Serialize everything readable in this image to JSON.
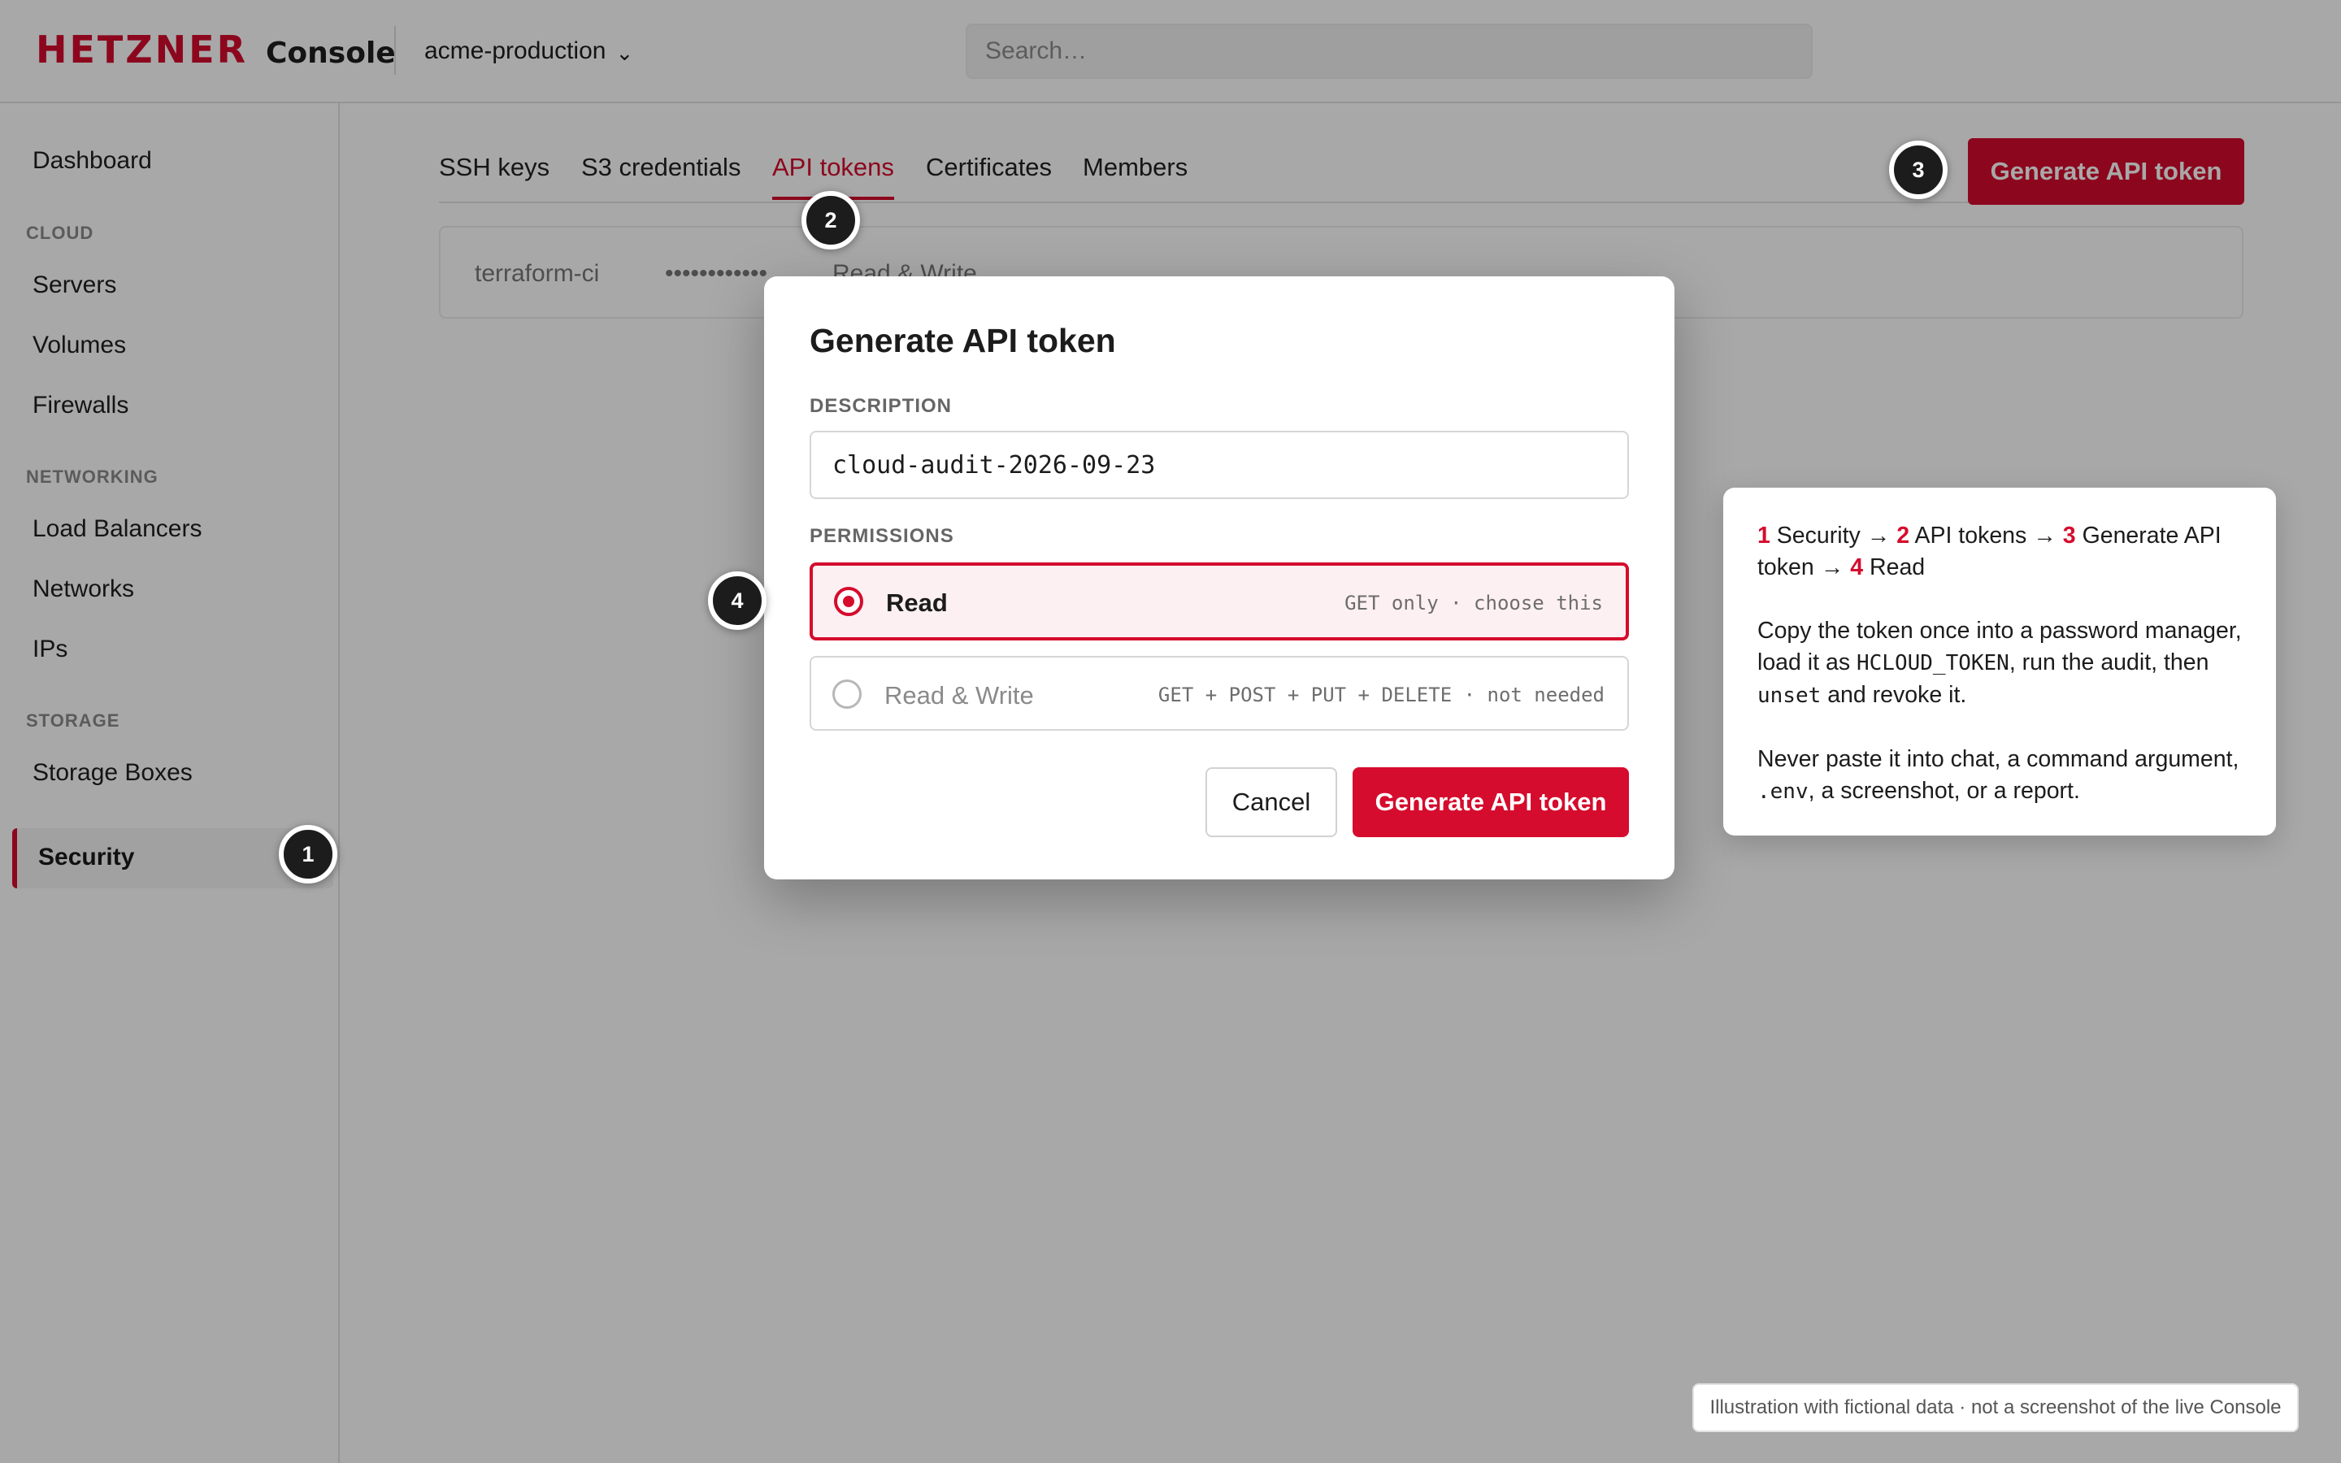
{
  "header": {
    "brand": "HETZNER",
    "product": "Console",
    "project": "acme-production",
    "project_chevron": "⌄",
    "search_placeholder": "Search…"
  },
  "sidebar": {
    "dashboard": "Dashboard",
    "sections": [
      {
        "title": "CLOUD",
        "items": [
          "Servers",
          "Volumes",
          "Firewalls"
        ]
      },
      {
        "title": "NETWORKING",
        "items": [
          "Load Balancers",
          "Networks",
          "IPs"
        ]
      },
      {
        "title": "STORAGE",
        "items": [
          "Storage Boxes"
        ]
      }
    ],
    "active_item": "Security"
  },
  "tabs": [
    "SSH keys",
    "S3 credentials",
    "API tokens",
    "Certificates",
    "Members"
  ],
  "active_tab": "API tokens",
  "page_action": "Generate API token",
  "token_row": {
    "name": "terraform-ci",
    "token_mask": "••••••••••••",
    "permission": "Read & Write"
  },
  "modal": {
    "title": "Generate API token",
    "description_label": "DESCRIPTION",
    "description_value": "cloud-audit-2026-09-23",
    "permissions_label": "PERMISSIONS",
    "options": [
      {
        "label": "Read",
        "hint": "GET only · choose this",
        "selected": true
      },
      {
        "label": "Read & Write",
        "hint": "GET + POST + PUT + DELETE · not needed",
        "selected": false
      }
    ],
    "cancel_label": "Cancel",
    "submit_label": "Generate API token"
  },
  "callout": {
    "steps": [
      {
        "num": "1",
        "text": "Security"
      },
      {
        "num": "2",
        "text": "API tokens"
      },
      {
        "num": "3",
        "text": "Generate API token"
      },
      {
        "num": "4",
        "text": "Read"
      }
    ],
    "arrow": "→",
    "para2_a": "Copy the token once into a password manager, load it as ",
    "para2_code1": "HCLOUD_TOKEN",
    "para2_b": ", run the audit, then ",
    "para2_code2": "unset",
    "para2_c": " and revoke it.",
    "para3_a": "Never paste it into chat, a command argument, ",
    "para3_code": ".env",
    "para3_b": ", a screenshot, or a report."
  },
  "markers": [
    "1",
    "2",
    "3",
    "4"
  ],
  "disclaimer": "Illustration with fictional data · not a screenshot of the live Console",
  "colors": {
    "accent": "#d50c2d",
    "overlay": "rgba(0,0,0,0.34)",
    "marker": "#1c1c1c"
  }
}
